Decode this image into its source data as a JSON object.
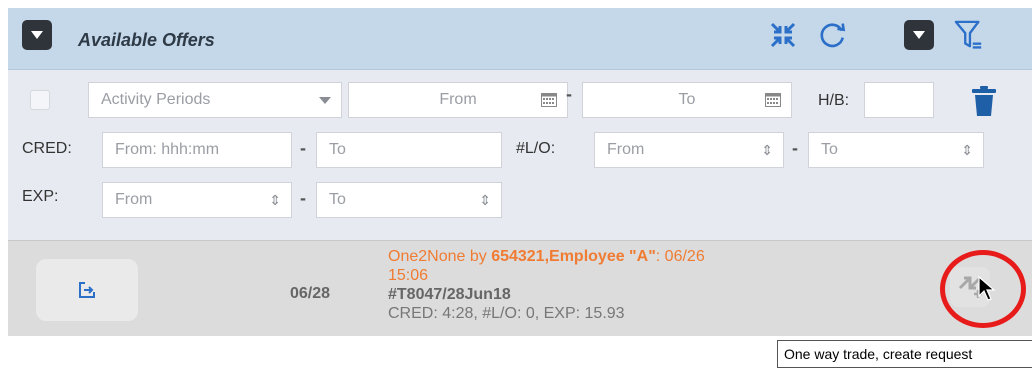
{
  "header": {
    "title": "Available Offers",
    "icons": [
      "chevron-down-icon",
      "collapse-icon",
      "refresh-icon",
      "chevron-down-icon",
      "filter-icon"
    ]
  },
  "filters": {
    "activity_select": "Activity Periods",
    "date_from_placeholder": "From",
    "date_to_placeholder": "To",
    "dash": "-",
    "hb_label": "H/B:",
    "cred_label": "CRED:",
    "cred_from_placeholder": "From: hhh:mm",
    "cred_to_placeholder": "To",
    "lo_label": "#L/O:",
    "lo_from_placeholder": "From",
    "lo_to_placeholder": "To",
    "exp_label": "EXP:",
    "exp_from_placeholder": "From",
    "exp_to_placeholder": "To"
  },
  "offer": {
    "date": "06/28",
    "line1_prefix": "One2None by ",
    "line1_emp": "654321,Employee \"A\"",
    "line1_suffix": ": 06/26",
    "line2": "15:06",
    "trip": "#T8047/28Jun18",
    "stats": "CRED: 4:28, #L/O: 0, EXP: 15.93"
  },
  "tooltip": "One way trade, create request",
  "colors": {
    "header_bg": "#c5d8ea",
    "filter_bg": "#e7ebf1",
    "accent_orange": "#f07c33",
    "highlight_red": "#e81b1b"
  }
}
